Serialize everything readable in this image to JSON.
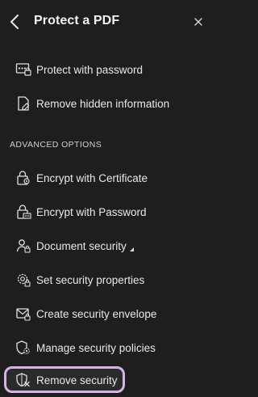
{
  "header": {
    "title": "Protect a PDF"
  },
  "items": [
    {
      "label": "Protect with password",
      "icon": "password-dots-icon"
    },
    {
      "label": "Remove hidden information",
      "icon": "document-eraser-icon"
    }
  ],
  "advanced": {
    "heading": "ADVANCED OPTIONS",
    "items": [
      {
        "label": "Encrypt with Certificate",
        "icon": "lock-certificate-icon"
      },
      {
        "label": "Encrypt with Password",
        "icon": "lock-password-icon"
      },
      {
        "label": "Document security",
        "icon": "user-lock-icon"
      },
      {
        "label": "Set security properties",
        "icon": "gear-lock-icon"
      },
      {
        "label": "Create security envelope",
        "icon": "envelope-icon"
      },
      {
        "label": "Manage security policies",
        "icon": "shield-gear-icon"
      },
      {
        "label": "Remove security",
        "icon": "shield-remove-icon"
      }
    ]
  },
  "colors": {
    "background": "#1e1e1e",
    "text": "#e8e8e8",
    "highlight_border": "#d9b3e6"
  }
}
